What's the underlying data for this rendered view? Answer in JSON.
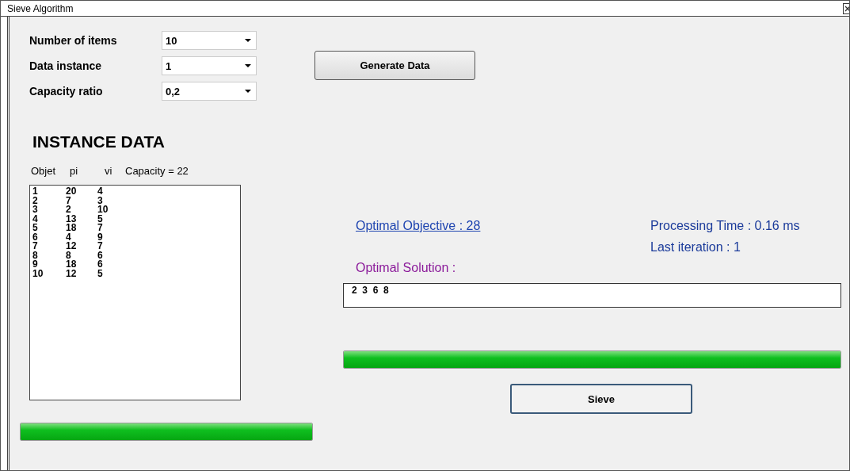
{
  "window": {
    "title": "Sieve Algorithm"
  },
  "settings": [
    {
      "label": "Number of items",
      "value": "10"
    },
    {
      "label": "Data instance",
      "value": "1"
    },
    {
      "label": "Capacity ratio",
      "value": "0,2"
    }
  ],
  "generate_button": "Generate Data",
  "instance_data": {
    "heading": "INSTANCE DATA",
    "columns": [
      "Objet",
      "pi",
      "vi"
    ],
    "capacity": "Capacity = 22",
    "rows": [
      [
        "1",
        "20",
        "4"
      ],
      [
        "2",
        "7",
        "3"
      ],
      [
        "3",
        "2",
        "10"
      ],
      [
        "4",
        "13",
        "5"
      ],
      [
        "5",
        "18",
        "7"
      ],
      [
        "6",
        "4",
        "9"
      ],
      [
        "7",
        "12",
        "7"
      ],
      [
        "8",
        "8",
        "6"
      ],
      [
        "9",
        "18",
        "6"
      ],
      [
        "10",
        "12",
        "5"
      ]
    ]
  },
  "data_progress": {
    "level": 1
  },
  "results": {
    "optimal_objective": "Optimal Objective : 28",
    "processing_time": "Processing Time : 0.16 ms",
    "last_iteration": "Last iteration : 1",
    "solution_label": "Optimal Solution :",
    "solution": "2  3  6  8"
  },
  "sieve_progress": {
    "level": 1
  },
  "sieve_button": "Sieve"
}
